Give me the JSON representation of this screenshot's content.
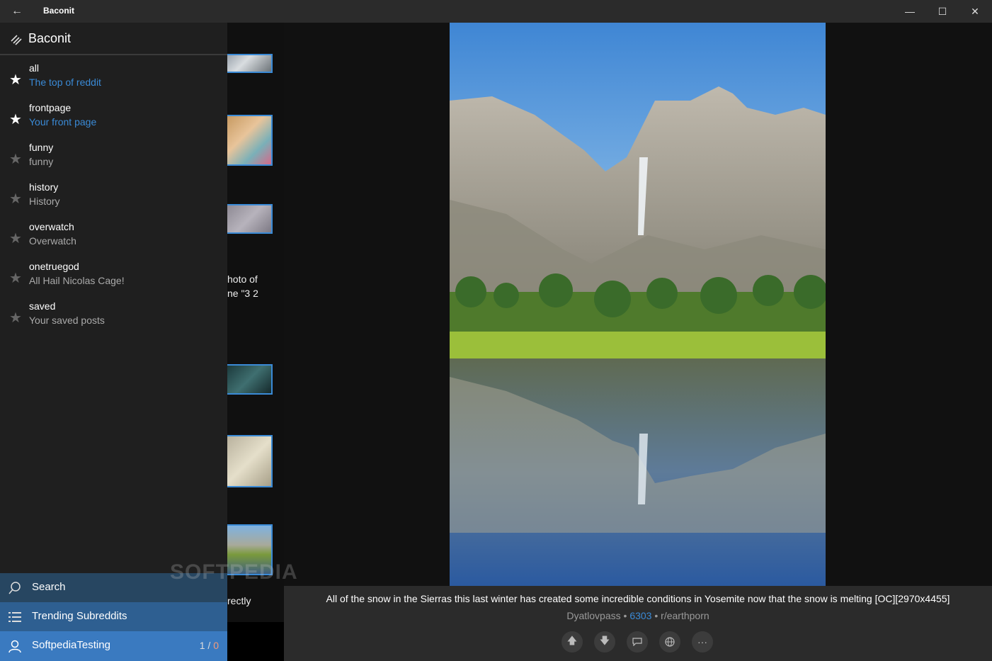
{
  "window": {
    "title": "Baconit"
  },
  "pane": {
    "title": "Baconit",
    "subreddits": [
      {
        "name": "all",
        "description": "The top of reddit",
        "favorite": true,
        "accent": true
      },
      {
        "name": "frontpage",
        "description": "Your front page",
        "favorite": true,
        "accent": true
      },
      {
        "name": "funny",
        "description": "funny",
        "favorite": false,
        "accent": false
      },
      {
        "name": "history",
        "description": "History",
        "favorite": false,
        "accent": false
      },
      {
        "name": "overwatch",
        "description": "Overwatch",
        "favorite": false,
        "accent": false
      },
      {
        "name": "onetruegod",
        "description": "All Hail Nicolas Cage!",
        "favorite": false,
        "accent": false
      },
      {
        "name": "saved",
        "description": "Your saved posts",
        "favorite": false,
        "accent": false
      }
    ],
    "bottom": {
      "search_label": "Search",
      "trending_label": "Trending Subreddits",
      "user_label": "SoftpediaTesting",
      "karma_link": "1",
      "karma_sep": " / ",
      "karma_comment": "0"
    }
  },
  "list_snippets": {
    "line1": "hoto of",
    "line2": "ne \"3 2",
    "line3": "rectly"
  },
  "post": {
    "title": "All of the snow in the Sierras this last winter has created some incredible conditions in Yosemite now that the snow is melting [OC][2970x4455]",
    "author": "Dyatlovpass",
    "score": "6303",
    "subreddit": "r/earthporn"
  },
  "watermark": "SOFTPEDIA",
  "colors": {
    "accent": "#3a8ad6",
    "pane_bg": "#1f1f1f",
    "titlebar": "#2b2b2b"
  }
}
